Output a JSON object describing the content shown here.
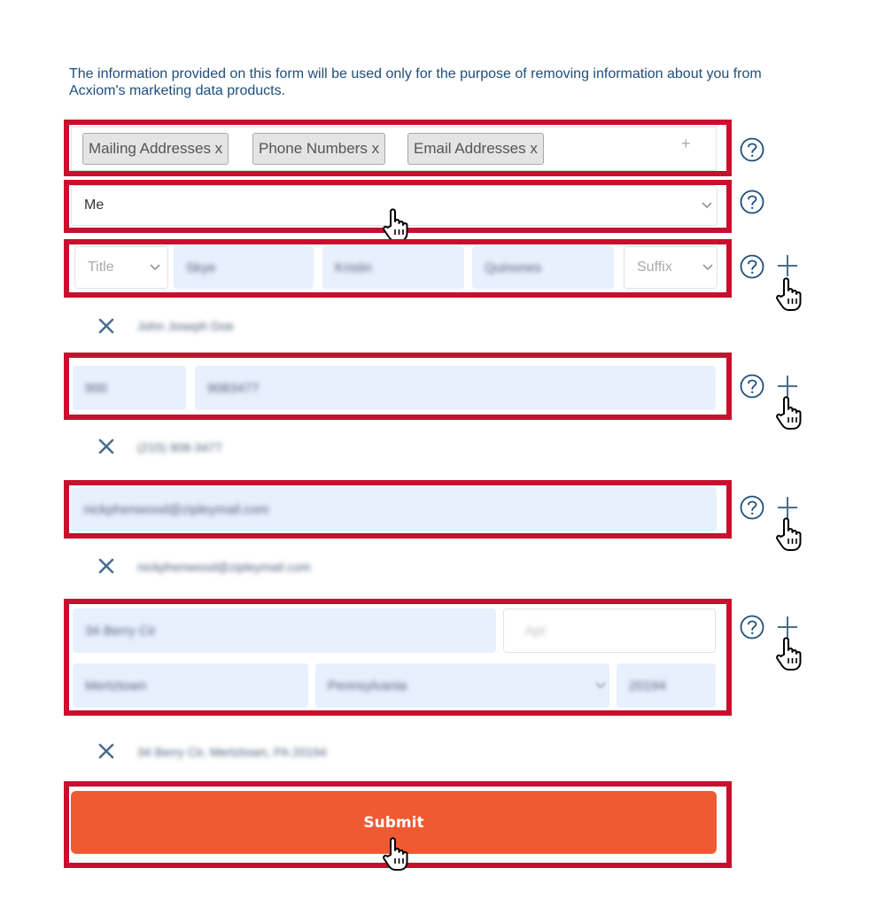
{
  "intro": {
    "text": "The information provided on this form will be used only for the purpose of removing information about you from Acxiom's marketing data products."
  },
  "categories": {
    "chips": [
      "Mailing Addresses x",
      "Phone Numbers x",
      "Email Addresses x"
    ],
    "add_symbol": "+"
  },
  "requester": {
    "selected": "Me"
  },
  "name": {
    "title_placeholder": "Title",
    "first": "Skye",
    "middle": "Kristin",
    "last": "Quinones",
    "suffix_placeholder": "Suffix",
    "saved": "John Joseph Doe"
  },
  "phone": {
    "area_code": "900",
    "number": "9083477",
    "saved": "(215) 908-3477"
  },
  "email": {
    "value": "nickphenwood@zipleymail.com",
    "saved": "nickphenwood@zipleymail.com"
  },
  "address": {
    "street": "34 Berry Cir",
    "apt_placeholder": "Apt",
    "city": "Mertztown",
    "state": "Pennsylvania",
    "zip": "20194",
    "saved": "34 Berry Cir, Mertztown, PA 20194"
  },
  "submit": {
    "label": "Submit"
  },
  "colors": {
    "highlight": "#c8102e",
    "submit": "#f05a32",
    "field_bg": "#e8f0fe",
    "icon": "#1f4e79"
  }
}
